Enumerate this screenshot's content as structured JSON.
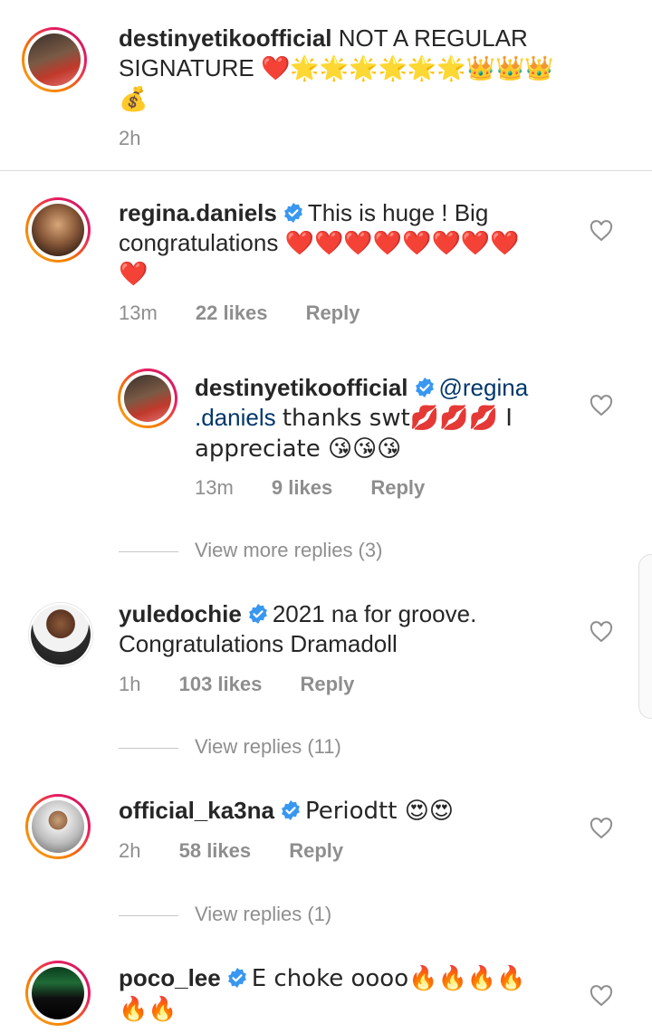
{
  "comments": [
    {
      "username": "destinyetikoofficial",
      "text": "NOT A REGULAR SIGNATURE",
      "emoji_line": "❤️🌟🌟🌟🌟🌟🌟👑👑👑",
      "emoji_line2": "💰",
      "time": "2h"
    },
    {
      "username": "regina.daniels",
      "text": "This is huge ! Big congratulations",
      "emojis": "❤️❤️❤️❤️❤️❤️❤️❤️",
      "emojis2": "❤️",
      "time": "13m",
      "likes": "22 likes",
      "reply": "Reply",
      "replies": [
        {
          "username": "destinyetikoofficial",
          "mention": "@regina .daniels",
          "mention_part1": "@regina",
          "mention_part2": ".daniels",
          "text": "thanks swt💋💋💋 I",
          "text2": "appreciate 😘😘😘",
          "time": "13m",
          "likes": "9 likes",
          "reply": "Reply"
        }
      ],
      "more_replies": "View more replies (3)"
    },
    {
      "username": "yuledochie",
      "text": "2021 na for groove.",
      "text2": "Congratulations Dramadoll",
      "time": "1h",
      "likes": "103 likes",
      "reply": "Reply",
      "more_replies": "View replies (11)"
    },
    {
      "username": "official_ka3na",
      "text": "Periodtt 😍😍",
      "time": "2h",
      "likes": "58 likes",
      "reply": "Reply",
      "more_replies": "View replies (1)"
    },
    {
      "username": "poco_lee",
      "text": "E choke oooo🔥🔥🔥🔥",
      "text2": "🔥🔥"
    }
  ],
  "colors": {
    "verified": "#3897f0",
    "meta": "#8e8e8e",
    "heart": "#e0182d"
  }
}
